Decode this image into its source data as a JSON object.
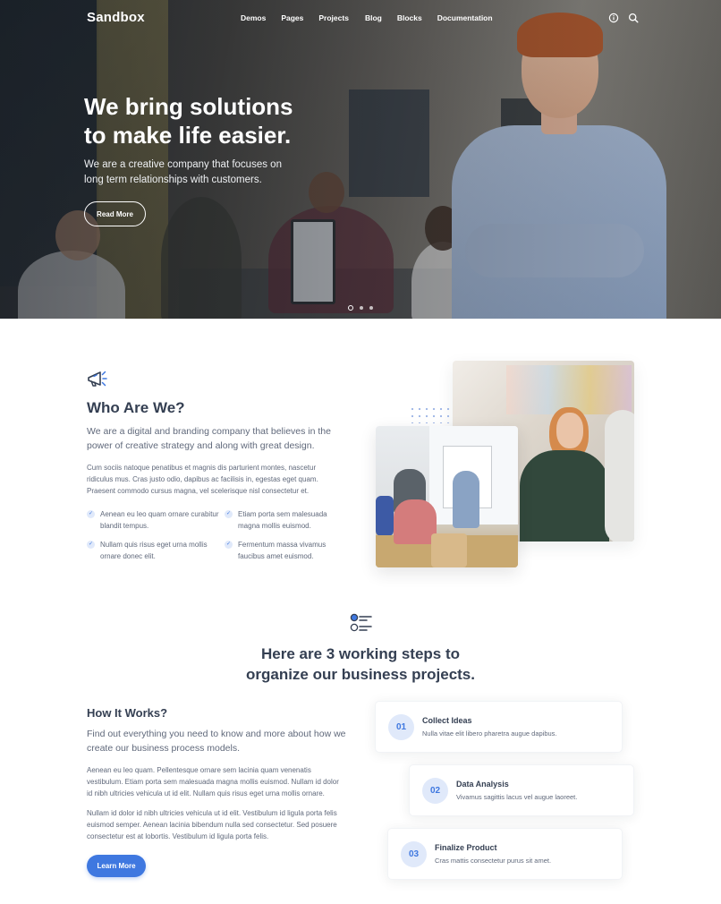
{
  "brand": {
    "logo": "Sandbox",
    "accent": "#3f78e0",
    "heading_color": "#343f52",
    "text_color": "#60697b"
  },
  "nav": {
    "items": [
      "Demos",
      "Pages",
      "Projects",
      "Blog",
      "Blocks",
      "Documentation"
    ],
    "icons": [
      "info-icon",
      "search-icon"
    ]
  },
  "hero": {
    "title_line1": "We bring solutions",
    "title_line2": "to make life easier.",
    "text": "We are a creative company that focuses on long term relationships with customers.",
    "button": "Read More",
    "slides_total": 3,
    "slide_active": 1
  },
  "about": {
    "icon": "megaphone-icon",
    "title": "Who Are We?",
    "lead": "We are a digital and branding company that believes in the power of creative strategy and along with great design.",
    "body": "Cum sociis natoque penatibus et magnis dis parturient montes, nascetur ridiculus mus. Cras justo odio, dapibus ac facilisis in, egestas eget quam. Praesent commodo cursus magna, vel scelerisque nisl consectetur et.",
    "checks": [
      "Aenean eu leo quam ornare curabitur blandit tempus.",
      "Etiam porta sem malesuada magna mollis euismod.",
      "Nullam quis risus eget urna mollis ornare donec elit.",
      "Fermentum massa vivamus faucibus amet euismod."
    ]
  },
  "steps": {
    "icon": "checklist-icon",
    "title_line1": "Here are 3 working steps to",
    "title_line2": "organize our business projects.",
    "how_title": "How It Works?",
    "how_lead": "Find out everything you need to know and more about how we create our business process models.",
    "how_p1": "Aenean eu leo quam. Pellentesque ornare sem lacinia quam venenatis vestibulum. Etiam porta sem malesuada magna mollis euismod. Nullam id dolor id nibh ultricies vehicula ut id elit. Nullam quis risus eget urna mollis ornare.",
    "how_p2": "Nullam id dolor id nibh ultricies vehicula ut id elit. Vestibulum id ligula porta felis euismod semper. Aenean lacinia bibendum nulla sed consectetur. Sed posuere consectetur est at lobortis. Vestibulum id ligula porta felis.",
    "button": "Learn More",
    "cards": [
      {
        "num": "01",
        "title": "Collect Ideas",
        "desc": "Nulla vitae elit libero pharetra augue dapibus."
      },
      {
        "num": "02",
        "title": "Data Analysis",
        "desc": "Vivamus sagittis lacus vel augue laoreet."
      },
      {
        "num": "03",
        "title": "Finalize Product",
        "desc": "Cras mattis consectetur purus sit amet."
      }
    ]
  }
}
